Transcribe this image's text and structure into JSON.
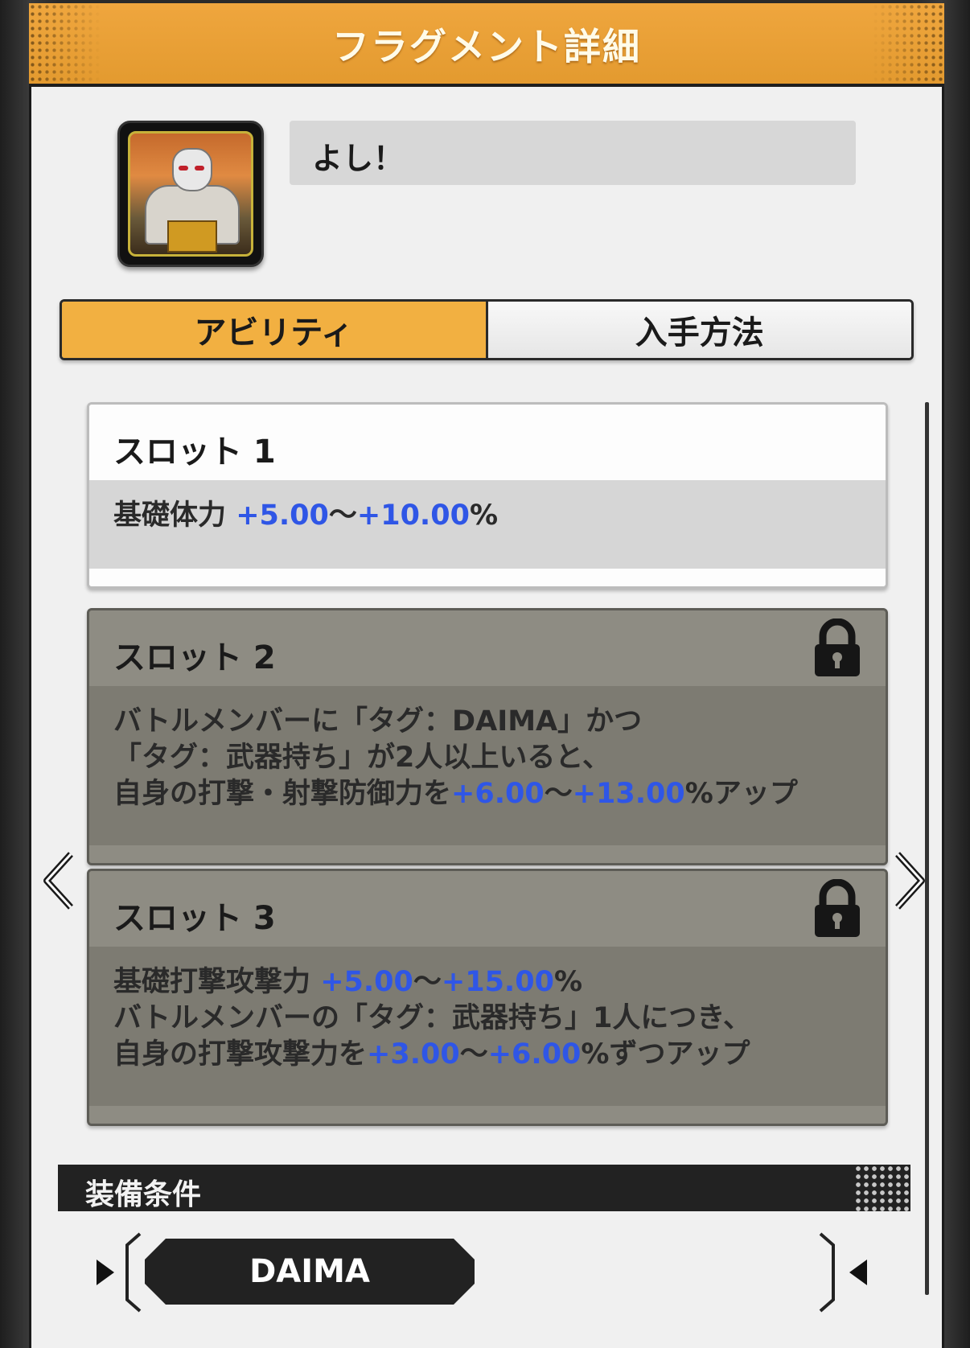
{
  "header": {
    "title": "フラグメント詳細"
  },
  "fragment": {
    "name": "よし！",
    "avatar_icon": "character-portrait-icon"
  },
  "tabs": [
    {
      "label": "アビリティ",
      "active": true
    },
    {
      "label": "入手方法",
      "active": false
    }
  ],
  "slots": [
    {
      "title": "スロット 1",
      "locked": false,
      "lines": [
        [
          {
            "t": "基礎体力 "
          },
          {
            "t": "+5.00",
            "b": true
          },
          {
            "t": "〜"
          },
          {
            "t": "+10.00",
            "b": true
          },
          {
            "t": "%"
          }
        ]
      ]
    },
    {
      "title": "スロット 2",
      "locked": true,
      "lines": [
        [
          {
            "t": "バトルメンバーに「タグ：DAIMA」かつ"
          }
        ],
        [
          {
            "t": "「タグ：武器持ち」が2人以上いると、"
          }
        ],
        [
          {
            "t": "自身の打撃・射撃防御力を"
          },
          {
            "t": "+6.00",
            "b": true
          },
          {
            "t": "〜"
          },
          {
            "t": "+13.00",
            "b": true
          },
          {
            "t": "%アップ"
          }
        ]
      ]
    },
    {
      "title": "スロット 3",
      "locked": true,
      "lines": [
        [
          {
            "t": "基礎打撃攻撃力 "
          },
          {
            "t": "+5.00",
            "b": true
          },
          {
            "t": "〜"
          },
          {
            "t": "+15.00",
            "b": true
          },
          {
            "t": "%"
          }
        ],
        [
          {
            "t": "バトルメンバーの「タグ：武器持ち」1人につき、"
          }
        ],
        [
          {
            "t": "自身の打撃攻撃力を"
          },
          {
            "t": "+3.00",
            "b": true
          },
          {
            "t": "〜"
          },
          {
            "t": "+6.00",
            "b": true
          },
          {
            "t": "%ずつアップ"
          }
        ]
      ]
    }
  ],
  "requirements": {
    "title": "装備条件",
    "tags": [
      "DAIMA"
    ]
  },
  "icons": {
    "prev": "chevron-left-icon",
    "next": "chevron-right-icon",
    "lock": "lock-icon"
  },
  "colors": {
    "accent": "#f2b041",
    "highlight": "#2f56e6",
    "locked_bg": "#7d7b72"
  }
}
